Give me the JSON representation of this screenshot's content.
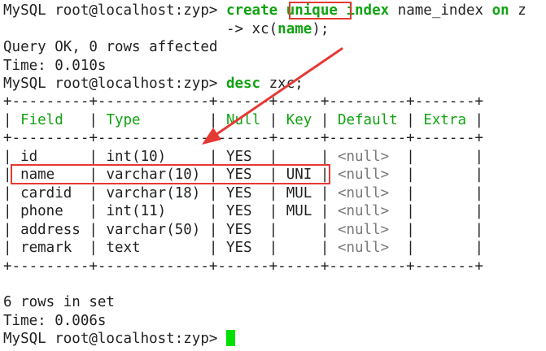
{
  "terminal": {
    "prompt": "MySQL root@localhost:zyp> ",
    "cmd1_kw1": "create",
    "cmd1_kw2": "unique",
    "cmd1_kw3": "index",
    "cmd1_name": "name_index",
    "cmd1_kw4": "on",
    "cmd1_tail": "z",
    "continuation_prompt": "-> ",
    "cmd1_line2_a": "xc(",
    "cmd1_line2_col": "name",
    "cmd1_line2_b": ");",
    "result1": "Query OK, 0 rows affected",
    "time1": "Time: 0.010s",
    "cmd2_kw": "desc",
    "cmd2_arg": "zxc;",
    "border_line": "+---------+-------------+------+-----+---------+-------+",
    "headers": [
      "Field",
      "Type",
      "Null",
      "Key",
      "Default",
      "Extra"
    ],
    "rows": [
      [
        "id",
        "int(10)",
        "YES",
        "",
        "<null>",
        ""
      ],
      [
        "name",
        "varchar(10)",
        "YES",
        "UNI",
        "<null>",
        ""
      ],
      [
        "cardid",
        "varchar(18)",
        "YES",
        "MUL",
        "<null>",
        ""
      ],
      [
        "phone",
        "int(11)",
        "YES",
        "MUL",
        "<null>",
        ""
      ],
      [
        "address",
        "varchar(50)",
        "YES",
        "",
        "<null>",
        ""
      ],
      [
        "remark",
        "text",
        "YES",
        "",
        "<null>",
        ""
      ]
    ],
    "result2": "6 rows in set",
    "time2": "Time: 0.006s"
  },
  "colors": {
    "keyword": "#12a312",
    "annotation": "#e53935",
    "cursor": "#00e000"
  }
}
